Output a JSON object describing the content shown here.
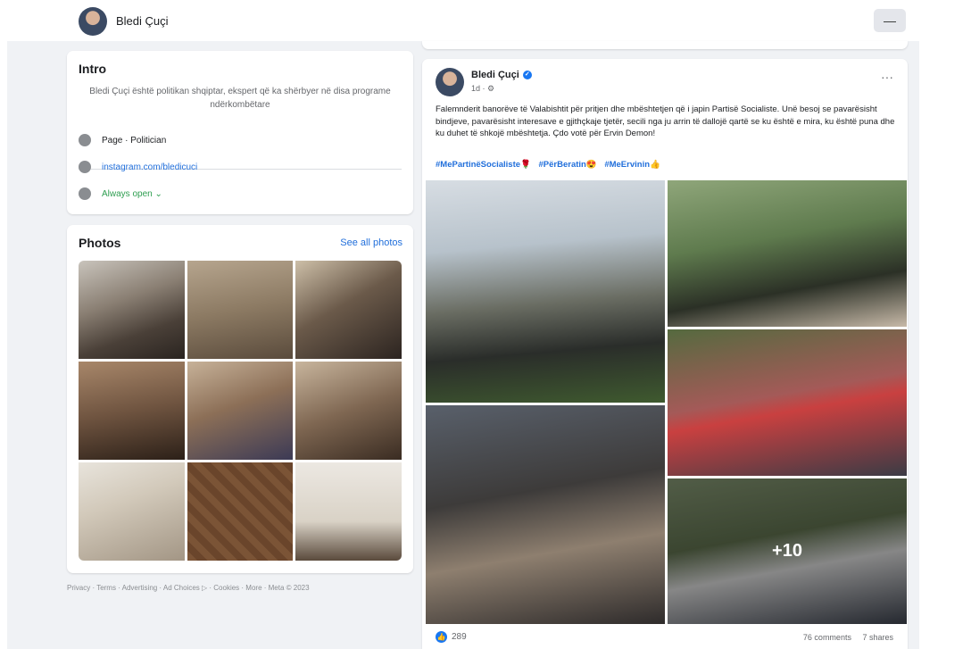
{
  "header": {
    "name": "Bledi Çuçi",
    "more_label": "—"
  },
  "intro": {
    "title": "Intro",
    "bio": "Bledi Çuçi është politikan shqiptar, ekspert që ka shërbyer në disa programe ndërkombëtare",
    "category": "Page · Politician",
    "instagram": "instagram.com/bledicuci",
    "hours": "Always open ⌄"
  },
  "photos": {
    "title": "Photos",
    "see_all": "See all photos"
  },
  "footer": {
    "links": "Privacy · Terms · Advertising · Ad Choices ▷ · Cookies · More · Meta © 2023"
  },
  "post": {
    "author": "Bledi Çuçi",
    "meta": "1d · ⚙",
    "more": "···",
    "text": "Falemnderit banorëve të Valabishtit për pritjen dhe mbështetjen që i japin Partisë Socialiste. Unë besoj se pavarësisht bindjeve, pavarësisht interesave e gjithçkaje tjetër, secili nga ju arrin të dallojë qartë se ku është e mira, ku është puna dhe ku duhet të shkojë mbështetja. Çdo votë për Ervin Demon!",
    "hashtags": [
      "#MePartinëSocialiste🌹",
      "#PërBeratin😍",
      "#MeErvinin👍"
    ],
    "more_photos": "+10",
    "reactions_count": "289",
    "comments": "76 comments",
    "shares": "7 shares"
  }
}
